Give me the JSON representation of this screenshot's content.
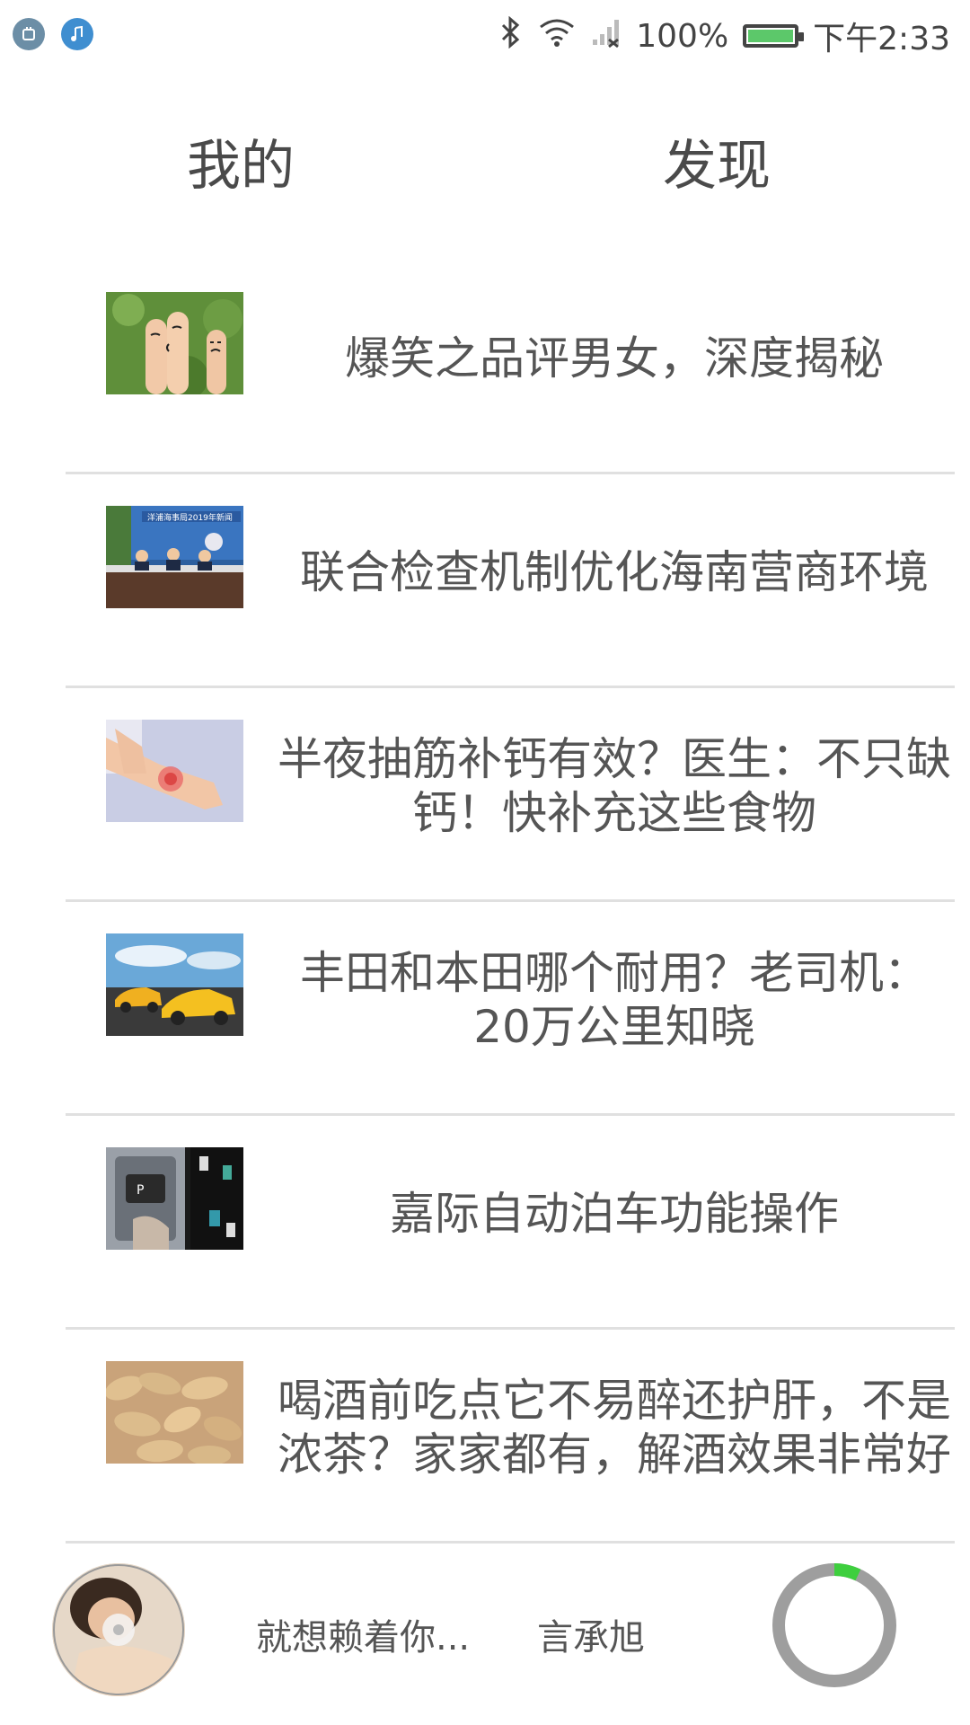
{
  "status_bar": {
    "battery_percent": "100%",
    "battery_level": 1.0,
    "time": "下午2:33",
    "icons": [
      "notification-app-icon",
      "music-app-icon",
      "bluetooth-icon",
      "wifi-icon",
      "signal-icon",
      "battery-icon"
    ]
  },
  "tabs": [
    {
      "label": "我的"
    },
    {
      "label": "发现"
    }
  ],
  "articles": [
    {
      "title": "爆笑之品评男女，深度揭秘",
      "image": "finger-faces-thumbnail"
    },
    {
      "title": "联合检查机制优化海南营商环境",
      "image": "press-conference-thumbnail"
    },
    {
      "title": "半夜抽筋补钙有效？医生：不只缺钙！快补充这些食物",
      "image": "leg-cramp-thumbnail"
    },
    {
      "title": "丰田和本田哪个耐用？老司机：20万公里知晓",
      "image": "yellow-sports-cars-thumbnail"
    },
    {
      "title": "嘉际自动泊车功能操作",
      "image": "parking-assist-thumbnail"
    },
    {
      "title": "喝酒前吃点它不易醉还护肝，不是浓茶？家家都有，解酒效果非常好",
      "image": "ginger-thumbnail"
    }
  ],
  "player": {
    "song": "就想赖着你...",
    "artist": "言承旭",
    "progress": 0.07,
    "colors": {
      "progress_track": "#9e9e9e",
      "progress_fill": "#3ecf3e"
    }
  }
}
